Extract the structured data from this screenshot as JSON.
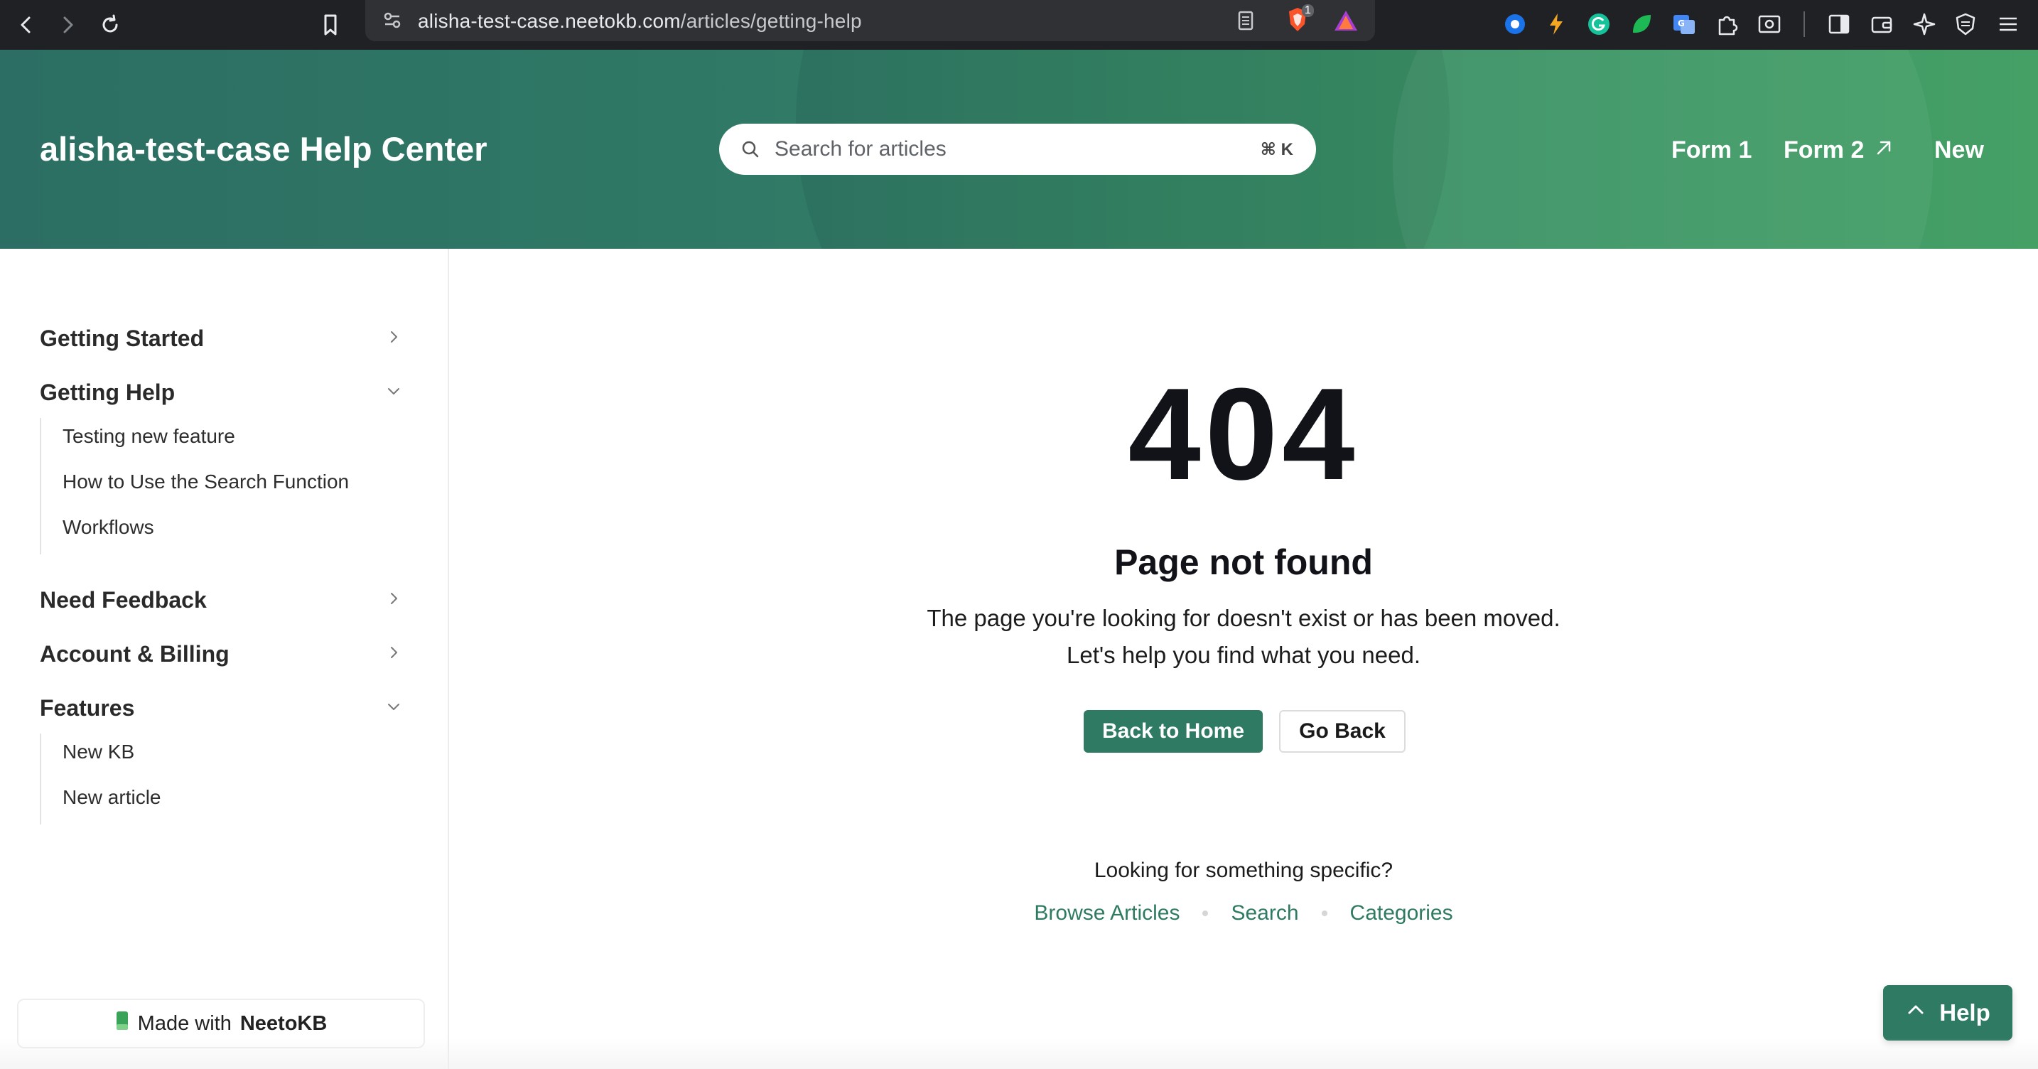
{
  "browser": {
    "url_domain": "alisha-test-case.neetokb.com",
    "url_path": "/articles/getting-help",
    "shield_badge": "1",
    "icons": [
      "back-icon",
      "forward-icon",
      "reload-icon",
      "bookmark-icon",
      "site-settings-icon",
      "reader-mode-icon",
      "brave-shield-icon",
      "brave-rewards-icon",
      "extension-icon",
      "sidebar-icon",
      "wallet-icon",
      "leo-ai-icon",
      "vpn-icon",
      "menu-icon"
    ]
  },
  "header": {
    "title": "alisha-test-case Help Center",
    "search_placeholder": "Search for articles",
    "search_shortcut": "⌘ K",
    "links": {
      "form1": "Form 1",
      "form2": "Form 2",
      "new": "New"
    }
  },
  "sidebar": {
    "categories": [
      {
        "label": "Getting Started",
        "expanded": false
      },
      {
        "label": "Getting Help",
        "expanded": true,
        "articles": [
          "Testing new feature",
          "How to Use the Search Function",
          "Workflows"
        ]
      },
      {
        "label": "Need Feedback",
        "expanded": false
      },
      {
        "label": "Account & Billing",
        "expanded": false
      },
      {
        "label": "Features",
        "expanded": true,
        "articles": [
          "New KB",
          "New article"
        ]
      }
    ],
    "made_with_prefix": "Made with",
    "made_with_brand": "NeetoKB"
  },
  "error": {
    "code": "404",
    "title": "Page not found",
    "description": "The page you're looking for doesn't exist or has been moved. Let's help you find what you need.",
    "home_button": "Back to Home",
    "back_button": "Go Back",
    "looking_text": "Looking for something specific?",
    "links": [
      "Browse Articles",
      "Search",
      "Categories"
    ]
  },
  "help_widget": {
    "label": "Help"
  },
  "colors": {
    "accent": "#2f7a63",
    "header_start": "#2c6e63",
    "header_end": "#45a066"
  }
}
